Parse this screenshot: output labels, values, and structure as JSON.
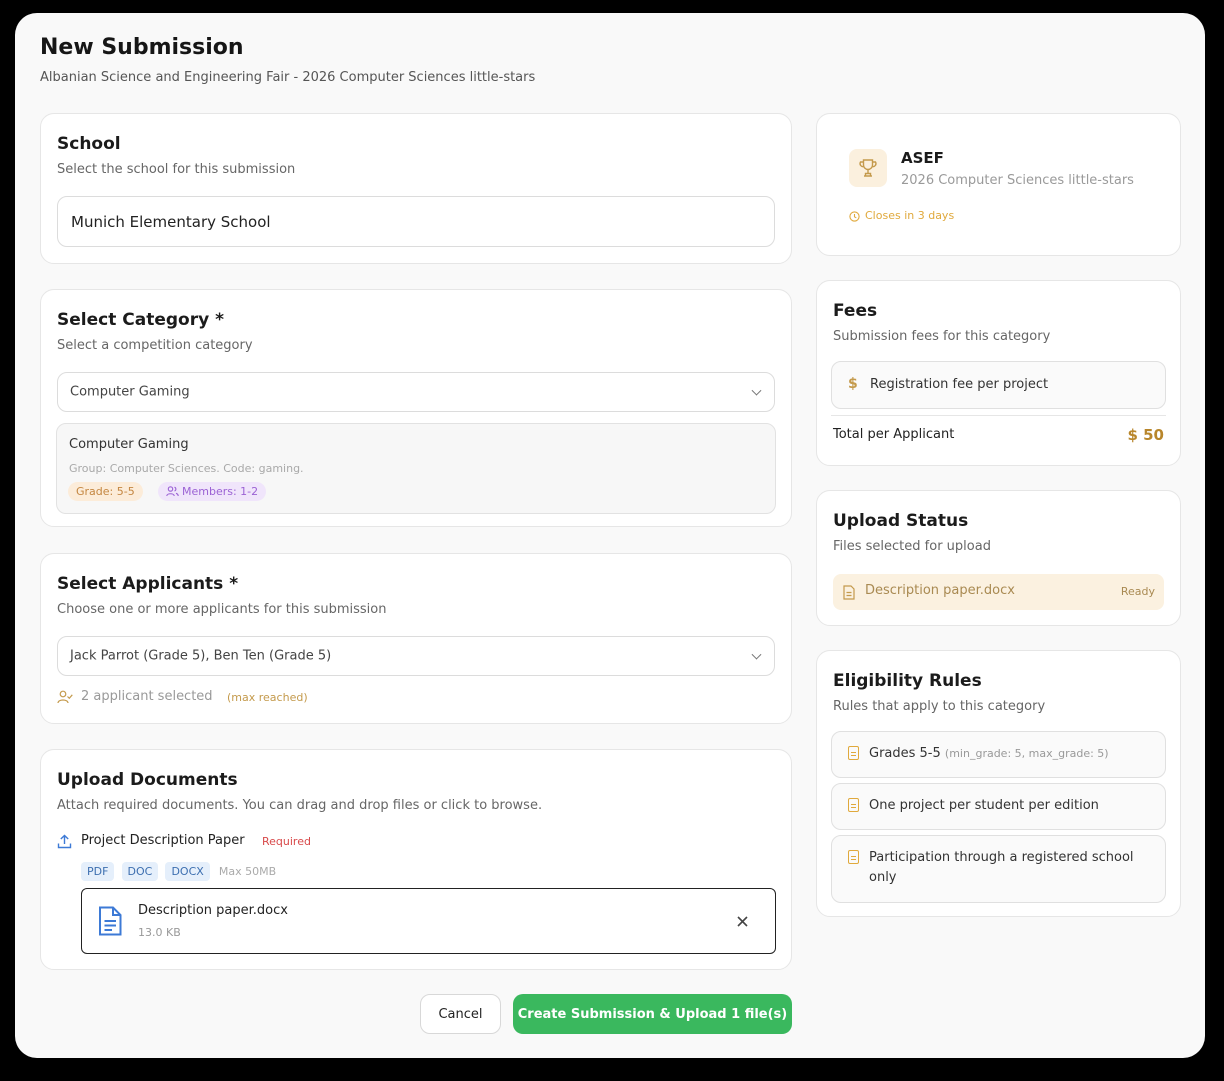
{
  "header": {
    "title": "New Submission",
    "subtitle": "Albanian Science and Engineering Fair - 2026 Computer Sciences little-stars"
  },
  "school": {
    "title": "School",
    "subtitle": "Select the school for this submission",
    "value": "Munich Elementary School"
  },
  "category": {
    "title": "Select Category *",
    "subtitle": "Select a competition category",
    "selected": "Computer Gaming",
    "detail_name": "Computer Gaming",
    "detail_meta": "Group: Computer Sciences. Code: gaming.",
    "grade_badge": "Grade: 5-5",
    "members_badge": "Members: 1-2"
  },
  "applicants": {
    "title": "Select Applicants *",
    "subtitle": "Choose one or more applicants for this submission",
    "selected": "Jack Parrot (Grade 5), Ben Ten (Grade 5)",
    "count_text": "2 applicant selected",
    "max_note": "(max reached)"
  },
  "upload": {
    "title": "Upload Documents",
    "subtitle": "Attach required documents. You can drag and drop files or click to browse.",
    "doc_label": "Project Description Paper",
    "required_label": "Required",
    "formats": [
      "PDF",
      "DOC",
      "DOCX"
    ],
    "max_size": "Max 50MB",
    "file_name": "Description paper.docx",
    "file_size": "13.0 KB"
  },
  "event": {
    "name": "ASEF",
    "edition": "2026 Computer Sciences little-stars",
    "closes": "Closes in 3 days"
  },
  "fees": {
    "title": "Fees",
    "subtitle": "Submission fees for this category",
    "fee_label": "Registration fee per project",
    "total_label": "Total per Applicant",
    "total_value": "$ 50"
  },
  "upload_status": {
    "title": "Upload Status",
    "subtitle": "Files selected for upload",
    "file_name": "Description paper.docx",
    "status": "Ready"
  },
  "eligibility": {
    "title": "Eligibility Rules",
    "subtitle": "Rules that apply to this category",
    "rules": [
      {
        "text": "Grades 5-5",
        "note": "(min_grade: 5, max_grade: 5)"
      },
      {
        "text": "One project per student per edition",
        "note": ""
      },
      {
        "text": "Participation through a registered school only",
        "note": ""
      }
    ]
  },
  "actions": {
    "cancel": "Cancel",
    "submit": "Create Submission & Upload 1 file(s)"
  },
  "colors": {
    "accent_green": "#3ab85e",
    "accent_gold": "#b8862b"
  }
}
